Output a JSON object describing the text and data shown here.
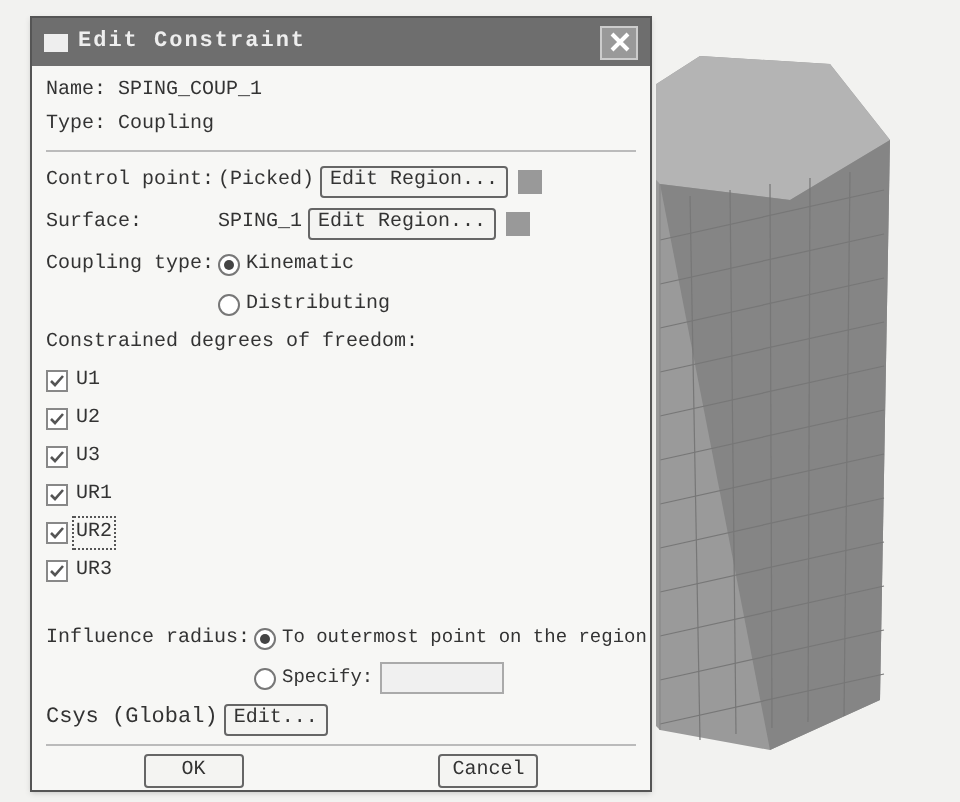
{
  "window": {
    "title": "Edit Constraint"
  },
  "name": {
    "label": "Name:",
    "value": "SPING_COUP_1"
  },
  "type": {
    "label": "Type:",
    "value": "Coupling"
  },
  "regions": [
    {
      "label": "Control point:",
      "value": "(Picked)",
      "button": "Edit Region..."
    },
    {
      "label": "Surface:",
      "value": "SPING_1",
      "button": "Edit Region..."
    }
  ],
  "coupling_type": {
    "label": "Coupling type:",
    "options": [
      {
        "label": "Kinematic",
        "selected": true
      },
      {
        "label": "Distributing",
        "selected": false
      }
    ]
  },
  "dof": {
    "label": "Constrained degrees of freedom:",
    "items": [
      {
        "label": "U1",
        "checked": true,
        "focused": false
      },
      {
        "label": "U2",
        "checked": true,
        "focused": false
      },
      {
        "label": "U3",
        "checked": true,
        "focused": false
      },
      {
        "label": "UR1",
        "checked": true,
        "focused": false
      },
      {
        "label": "UR2",
        "checked": true,
        "focused": true
      },
      {
        "label": "UR3",
        "checked": true,
        "focused": false
      }
    ]
  },
  "influence_radius": {
    "label": "Influence radius:",
    "options": [
      {
        "label": "To outermost point on the region",
        "selected": true,
        "kind": "plain"
      },
      {
        "label": "Specify:",
        "selected": false,
        "kind": "field"
      }
    ]
  },
  "csys": {
    "label": "Csys (Global)",
    "button": "Edit..."
  },
  "buttons": [
    "OK",
    "Cancel"
  ]
}
